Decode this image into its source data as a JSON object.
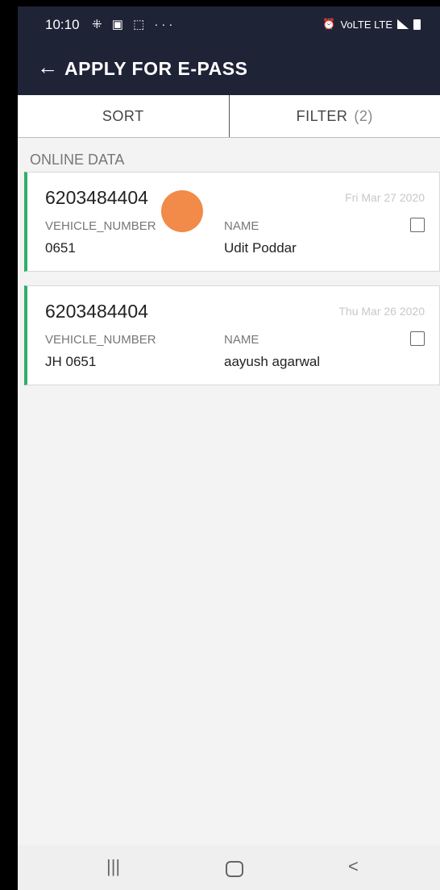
{
  "status": {
    "time": "10:10",
    "icons": "⁜ ▣ ⬚ ···",
    "right": "VoLTE LTE"
  },
  "app": {
    "title": "APPLY FOR E-PASS"
  },
  "actions": {
    "sort_label": "SORT",
    "filter_label": "FILTER",
    "filter_count": "(2)"
  },
  "section_label": "ONLINE DATA",
  "records": [
    {
      "phone": "6203484404",
      "date": "Fri Mar 27 2020",
      "vehicle_label": "VEHICLE_NUMBER",
      "vehicle_value": "0651",
      "name_label": "NAME",
      "name_value": "Udit Poddar"
    },
    {
      "phone": "6203484404",
      "date": "Thu Mar 26 2020",
      "vehicle_label": "VEHICLE_NUMBER",
      "vehicle_value": "JH 0651",
      "name_label": "NAME",
      "name_value": "aayush agarwal"
    }
  ],
  "nav": {
    "recents": "|||",
    "back": "<"
  },
  "colors": {
    "header": "#1f2336",
    "accent": "#2fae6a",
    "touch": "#f28a4a"
  }
}
